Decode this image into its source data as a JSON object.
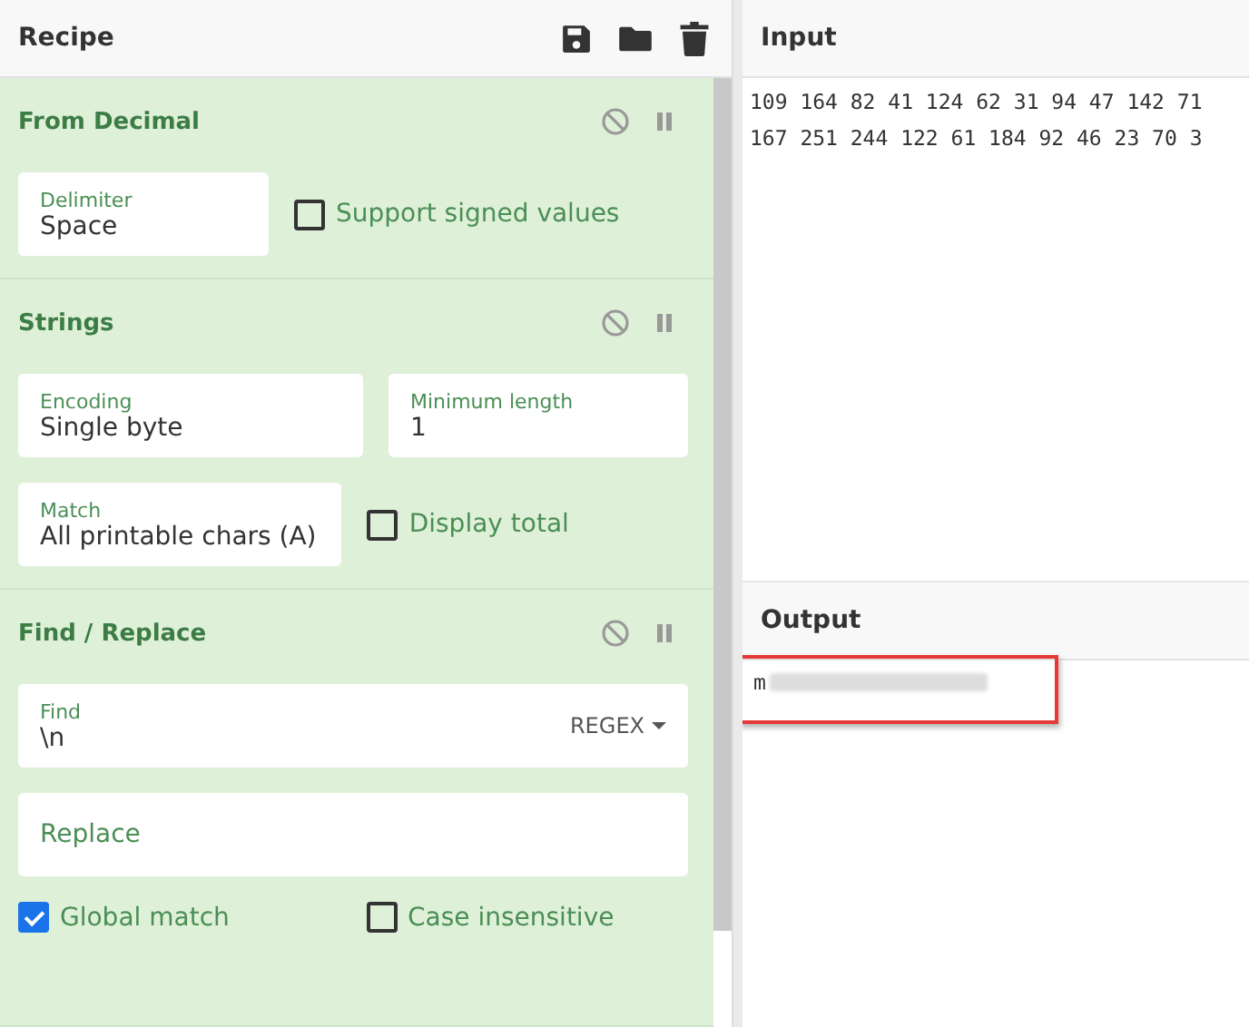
{
  "recipe": {
    "title": "Recipe",
    "operations": [
      {
        "title": "From Decimal",
        "rows": [
          [
            {
              "kind": "field",
              "label": "Delimiter",
              "value": "Space"
            },
            {
              "kind": "checkbox",
              "label": "Support signed values",
              "checked": false
            }
          ]
        ]
      },
      {
        "title": "Strings",
        "rows": [
          [
            {
              "kind": "field",
              "label": "Encoding",
              "value": "Single byte"
            },
            {
              "kind": "field",
              "label": "Minimum length",
              "value": "1"
            }
          ],
          [
            {
              "kind": "field",
              "label": "Match",
              "value": "All printable chars (A)"
            },
            {
              "kind": "checkbox",
              "label": "Display total",
              "checked": false
            }
          ]
        ]
      },
      {
        "title": "Find / Replace",
        "rows": [
          [
            {
              "kind": "field",
              "label": "Find",
              "value": "\\n",
              "option": "REGEX"
            }
          ],
          [
            {
              "kind": "field",
              "placeholder": "Replace"
            }
          ],
          [
            {
              "kind": "checkbox",
              "label": "Global match",
              "checked": true
            },
            {
              "kind": "checkbox",
              "label": "Case insensitive",
              "checked": false
            }
          ]
        ]
      }
    ]
  },
  "input": {
    "title": "Input",
    "lines": [
      "109 164 82 41 124 62 31 94 47 142 71",
      "167 251 244 122 61 184 92 46 23 70 3"
    ]
  },
  "output": {
    "title": "Output",
    "text": "m"
  }
}
